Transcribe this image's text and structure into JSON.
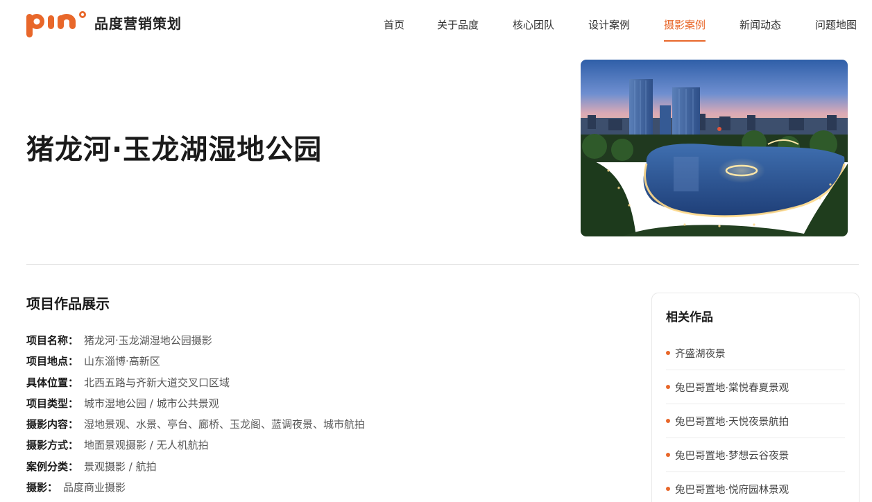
{
  "brand": {
    "logo_text": "PIN°",
    "name": "品度营销策划",
    "accent_color": "#e8672a"
  },
  "nav": {
    "items": [
      {
        "label": "首页"
      },
      {
        "label": "关于品度"
      },
      {
        "label": "核心团队"
      },
      {
        "label": "设计案例"
      },
      {
        "label": "摄影案例",
        "active": true
      },
      {
        "label": "新闻动态"
      },
      {
        "label": "问题地图"
      }
    ]
  },
  "hero": {
    "title": "猪龙河·玉龙湖湿地公园",
    "image_icon": "night-city-lake-aerial-photo"
  },
  "project": {
    "section_title": "项目作品展示",
    "rows": [
      {
        "label": "项目名称：",
        "value": "猪龙河·玉龙湖湿地公园摄影"
      },
      {
        "label": "项目地点：",
        "value": "山东淄博·高新区"
      },
      {
        "label": "具体位置：",
        "value": "北西五路与齐新大道交叉口区域"
      },
      {
        "label": "项目类型：",
        "value": "城市湿地公园 / 城市公共景观"
      },
      {
        "label": "摄影内容：",
        "value": "湿地景观、水景、亭台、廊桥、玉龙阁、蓝调夜景、城市航拍"
      },
      {
        "label": "摄影方式：",
        "value": "地面景观摄影 / 无人机航拍"
      },
      {
        "label": "案例分类：",
        "value": "景观摄影 / 航拍"
      },
      {
        "label": "摄影：",
        "value": "品度商业摄影"
      }
    ]
  },
  "related": {
    "title": "相关作品",
    "items": [
      {
        "label": "齐盛湖夜景"
      },
      {
        "label": "兔巴哥置地·棠悦春夏景观"
      },
      {
        "label": "兔巴哥置地·天悦夜景航拍"
      },
      {
        "label": "兔巴哥置地·梦想云谷夜景"
      },
      {
        "label": "兔巴哥置地·悦府园林景观"
      }
    ]
  }
}
